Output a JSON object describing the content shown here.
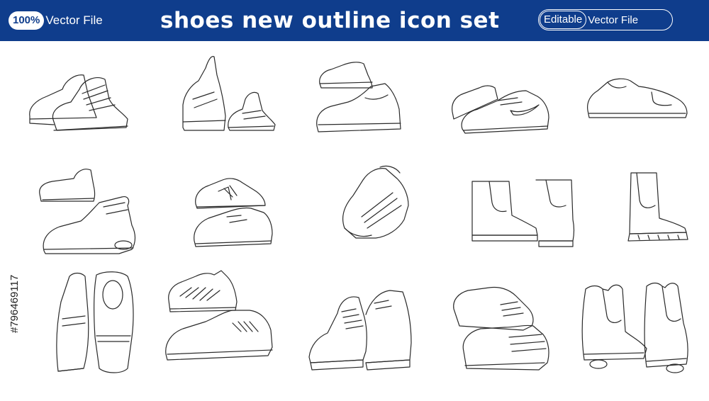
{
  "header": {
    "percent_badge": "100%",
    "left_label": "Vector File",
    "title": "shoes new outline icon set",
    "editable_label": "Editable",
    "right_label": "Vector File",
    "banner_color": "#0f3d8c"
  },
  "side_text": "#796469117",
  "icons": [
    "high-top-strap-sneakers-icon",
    "velcro-running-shoes-icon",
    "slip-on-sneakers-icon",
    "swoosh-sneakers-icon",
    "low-sneakers-icon",
    "sock-sneakers-icon",
    "stacked-running-shoes-icon",
    "striped-sneakers-pair-icon",
    "chelsea-boots-pair-icon",
    "chelsea-boot-icon",
    "loafers-icon",
    "knit-running-shoes-icon",
    "chukka-boots-icon",
    "striped-lace-shoes-icon",
    "ankle-boots-pair-icon"
  ]
}
